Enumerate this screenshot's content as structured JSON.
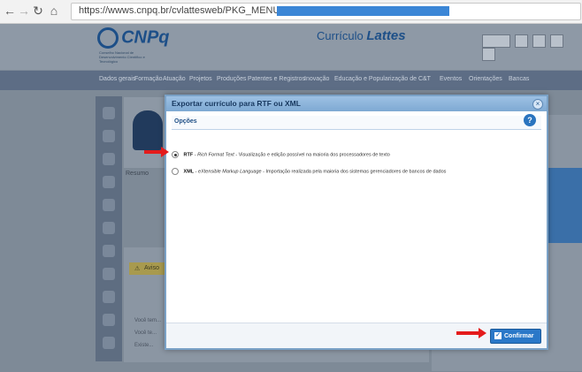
{
  "browser": {
    "url": "https://wwws.cnpq.br/cvlattesweb/PKG_MENU.menu?"
  },
  "site": {
    "logo_text": "CNPq",
    "logo_subtitle": "Conselho Nacional de Desenvolvimento Científico e Tecnológico",
    "lattes_prefix": "Currículo",
    "lattes_name": "Lattes",
    "menu": [
      "Dados gerais",
      "Formação",
      "Atuação",
      "Projetos",
      "Produções",
      "Patentes e Registros",
      "Inovação",
      "Educação e Popularização de C&T",
      "Eventos",
      "Orientações",
      "Bancas"
    ],
    "resumo_label": "Resumo",
    "warning_label": "Aviso",
    "faint_rows": [
      "Você tem...",
      "Você te...",
      "Existe..."
    ]
  },
  "dialog": {
    "title": "Exportar currículo para RTF ou XML",
    "section": "Opções",
    "options": [
      {
        "key": "RTF",
        "name": "Rich Format Text",
        "description": "Visualização e edição possível na maioria dos processadores de texto",
        "selected": true
      },
      {
        "key": "XML",
        "name": "eXtensible Markup Language",
        "description": "Importação realizada pela maioria dos sistemas gerenciadores de bancos de dados",
        "selected": false
      }
    ],
    "confirm_label": "Confirmar"
  },
  "colors": {
    "dialog_title": "#7ea9d3",
    "confirm": "#2a78c8",
    "annotation_arrow": "#e41b1b"
  }
}
